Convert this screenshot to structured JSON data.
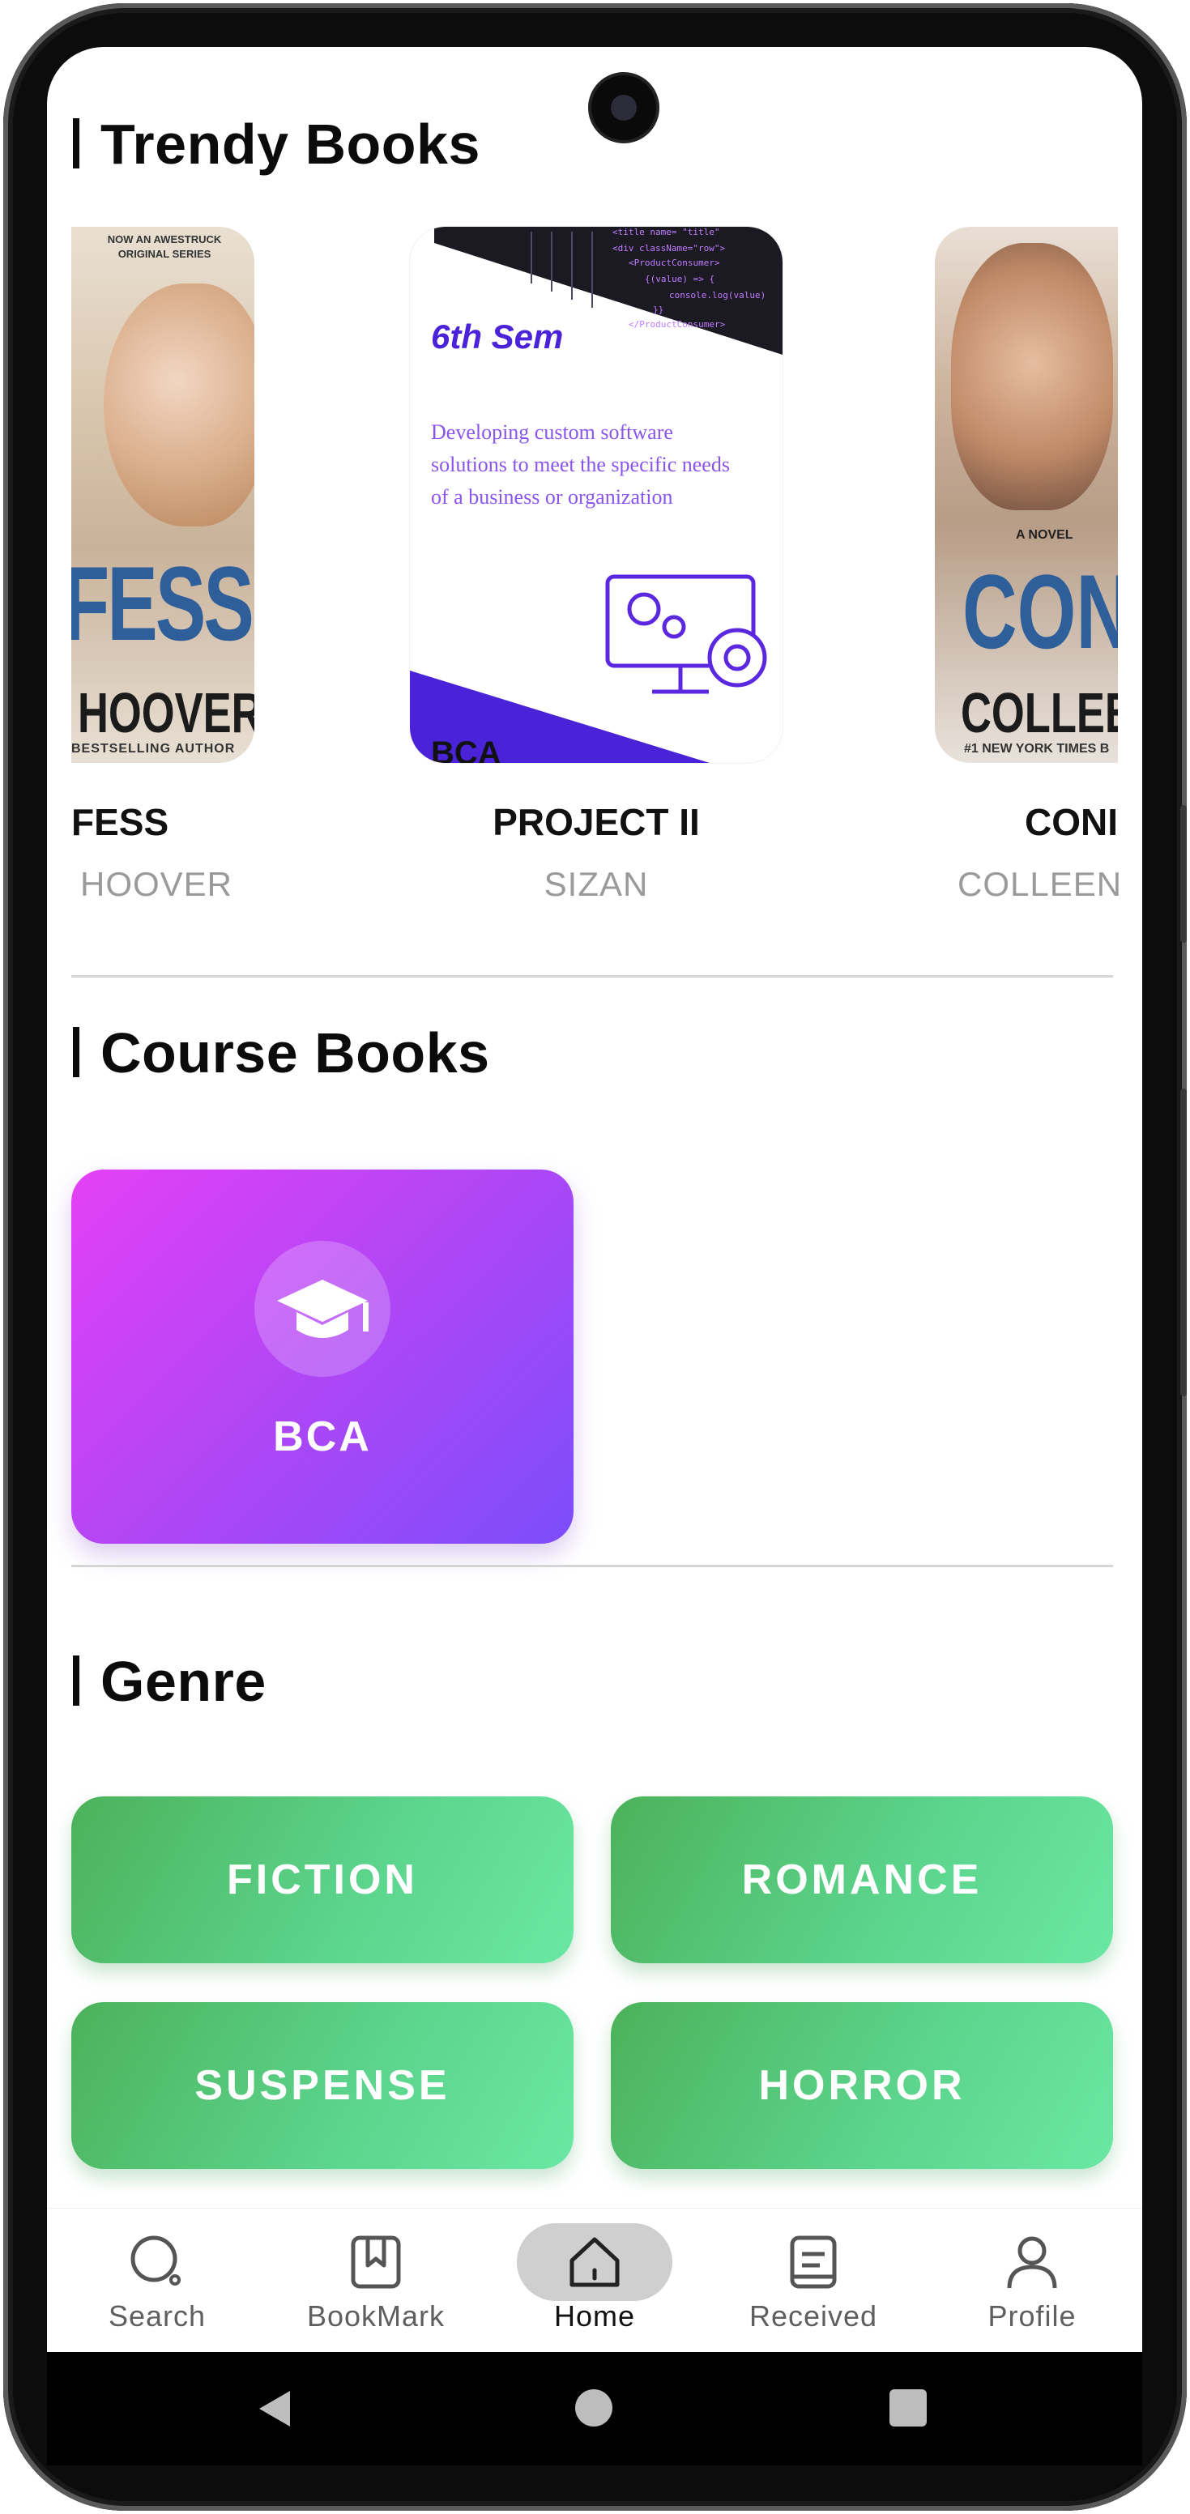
{
  "trendy": {
    "title": "Trendy Books",
    "books": [
      {
        "title": "FESS",
        "author": "HOOVER",
        "cover": {
          "top_small_1": "NOW AN AWESTRUCK",
          "top_small_2": "ORIGINAL SERIES",
          "big": "FESS",
          "author": "HOOVER",
          "bottom": "BESTSELLING AUTHOR"
        }
      },
      {
        "title": "PROJECT II",
        "author": "SIZAN",
        "cover": {
          "heading": "6th Sem",
          "desc": "Developing custom software solutions to meet the specific needs of a business or organization",
          "tag": "BCA"
        }
      },
      {
        "title": "CONI",
        "author": "COLLEEN",
        "cover": {
          "small": "A NOVEL",
          "big": "CONI",
          "author": "COLLEEN",
          "bottom": "#1 NEW YORK TIMES B"
        }
      }
    ]
  },
  "course": {
    "title": "Course Books",
    "card_label": "BCA",
    "icon": "graduation-cap-icon"
  },
  "genre": {
    "title": "Genre",
    "items": [
      "FICTION",
      "ROMANCE",
      "SUSPENSE",
      "HORROR"
    ]
  },
  "nav": {
    "items": [
      {
        "label": "Search",
        "icon": "search-icon"
      },
      {
        "label": "BookMark",
        "icon": "bookmark-icon"
      },
      {
        "label": "Home",
        "icon": "home-icon",
        "active": true
      },
      {
        "label": "Received",
        "icon": "received-icon"
      },
      {
        "label": "Profile",
        "icon": "profile-icon"
      }
    ]
  },
  "colors": {
    "course_gradient": [
      "#e440f6",
      "#7c4dfb"
    ],
    "genre_gradient": [
      "#4cb25a",
      "#6ae8a3"
    ],
    "active_pill": "#cfcfcf"
  }
}
